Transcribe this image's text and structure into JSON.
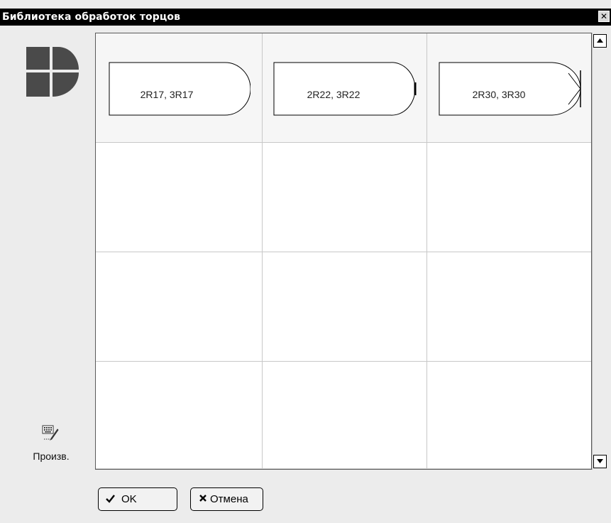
{
  "window": {
    "title": "Библиотека обработок торцов",
    "close_glyph": "✕"
  },
  "sidebar": {
    "logo_icon": "library-logo-icon",
    "manual_icon": "keyboard-pencil-icon",
    "manual_label": "Произв."
  },
  "grid": {
    "rows": 4,
    "columns": 3,
    "items": [
      {
        "label": "2R17, 3R17",
        "profile": "round"
      },
      {
        "label": "2R22, 3R22",
        "profile": "round-flat-tip"
      },
      {
        "label": "2R30, 3R30",
        "profile": "round-cross-tip"
      }
    ]
  },
  "buttons": {
    "ok_label": "OK",
    "ok_icon": "checkmark-icon",
    "cancel_label": "Отмена",
    "cancel_icon": "cross-icon"
  },
  "colors": {
    "titlebar": "#000000",
    "logo": "#4a4a4a",
    "background": "#ececec"
  }
}
